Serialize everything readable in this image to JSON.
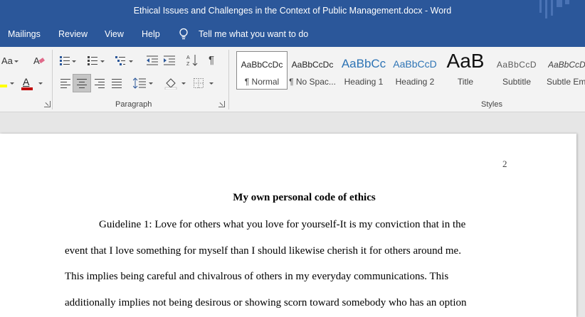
{
  "window": {
    "title": "Ethical Issues and Challenges in the Context of Public Management.docx  -  Word"
  },
  "menu": {
    "tabs": [
      "Mailings",
      "Review",
      "View",
      "Help"
    ],
    "tell_me": "Tell me what you want to do"
  },
  "ribbon": {
    "font_size_label": "Aa",
    "groups": {
      "paragraph": "Paragraph",
      "styles": "Styles"
    },
    "styles": [
      {
        "sample": "AaBbCcDc",
        "name": "¶ Normal"
      },
      {
        "sample": "AaBbCcDc",
        "name": "¶ No Spac..."
      },
      {
        "sample": "AaBbCc",
        "name": "Heading 1"
      },
      {
        "sample": "AaBbCcD",
        "name": "Heading 2"
      },
      {
        "sample": "AaB",
        "name": "Title"
      },
      {
        "sample": "AaBbCcD",
        "name": "Subtitle"
      },
      {
        "sample": "AaBbCcDd",
        "name": "Subtle Em..."
      }
    ],
    "colors": {
      "accent": "#2b579a",
      "highlight": "#ffff00",
      "font_color": "#c00000"
    }
  },
  "document": {
    "page_number": "2",
    "heading": "My own personal code of ethics",
    "lines": [
      "Guideline 1: Love for others what you love for yourself-It is my conviction that in the",
      "event that I love something for myself than I should likewise cherish it for others around me.",
      "This implies being careful and chivalrous of others in my everyday communications. This",
      "additionally implies not being desirous or showing scorn toward somebody who has an option"
    ]
  }
}
